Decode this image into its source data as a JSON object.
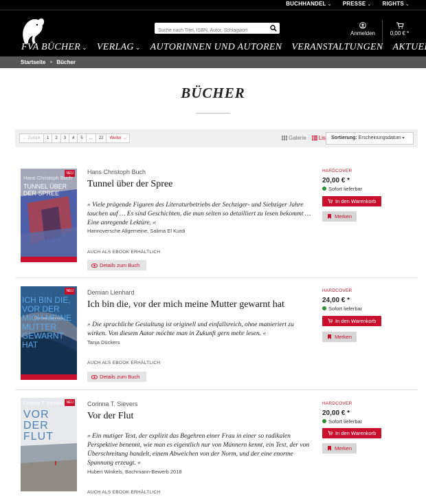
{
  "topbar": {
    "items": [
      {
        "label": "BUCHHANDEL"
      },
      {
        "label": "PRESSE"
      },
      {
        "label": "RIGHTS"
      }
    ]
  },
  "header": {
    "search_placeholder": "Suche nach Titel, ISBN, Autor, Schlagwort",
    "login_label": "Anmelden",
    "cart_label": "0,00 € *",
    "nav": [
      {
        "label": "FVA BÜCHER",
        "has_dropdown": true
      },
      {
        "label": "VERLAG",
        "has_dropdown": true
      },
      {
        "label": "AUTORINNEN UND AUTOREN",
        "has_dropdown": false
      },
      {
        "label": "VERANSTALTUNGEN",
        "has_dropdown": false
      },
      {
        "label": "AKTUELLES",
        "has_dropdown": false
      }
    ]
  },
  "breadcrumb": {
    "items": [
      "Startseite",
      "Bücher"
    ],
    "separator": "»"
  },
  "page": {
    "title": "BÜCHER"
  },
  "pagination": {
    "prev": "← Zurück",
    "pages": [
      "1",
      "2",
      "3",
      "4",
      "5",
      "...",
      "22"
    ],
    "next": "Weiter →"
  },
  "view": {
    "gallery": "Galerie",
    "list": "Liste",
    "active": "list"
  },
  "sort": {
    "label": "Sortierung:",
    "value": "Erscheinungsdatum"
  },
  "colors": {
    "accent": "#c8102e",
    "available": "#2e8b3a",
    "header_bg": "#000000",
    "breadcrumb_bg": "#555555"
  },
  "books": [
    {
      "author": "Hans Christoph Buch",
      "title": "Tunnel über der Spree",
      "badge": "NEU",
      "cover_author": "Hans Christoph Buch",
      "cover_title": "TUNNEL ÜBER DER SPREE",
      "quote": "» Viele prägende Figuren des Literaturbetriebs der Sechziger- und Siebziger Jahre tauchen auf … Es sind Geschichten, die man selten so detailliert zu lesen bekommt … Eine anregende Lektüre. «",
      "source": "Hannoversche Allgemeine, Salima El Kurdi",
      "ebook": "AUCH ALS EBOOK ERHÄLTLICH",
      "details": "Details zum Buch",
      "binding": "HARDCOVER",
      "price": "20,00 € *",
      "availability": "Sofort lieferbar",
      "cart_button": "In den Warenkorb",
      "remember_button": "Merken"
    },
    {
      "author": "Demian Lienhard",
      "title": "Ich bin die, vor der mich meine Mutter gewarnt hat",
      "badge": "NEU",
      "cover_author": "Demian Lienhard",
      "cover_title": "ICH BIN DIE, VOR DER MICH MEINE MUTTER GEWARNT HAT",
      "quote": "» Die sprachliche Gestaltung ist originell und einfallsreich, ohne manieriert zu wirken. Von diesem Autor möchte man in Zukunft gern mehr lesen. «",
      "source": "Tanja Dückers",
      "ebook": "AUCH ALS EBOOK ERHÄLTLICH",
      "details": "Details zum Buch",
      "binding": "HARDCOVER",
      "price": "24,00 € *",
      "availability": "Sofort lieferbar",
      "cart_button": "In den Warenkorb",
      "remember_button": "Merken"
    },
    {
      "author": "Corinna T. Sievers",
      "title": "Vor der Flut",
      "badge": "NEU",
      "cover_author": "Corinna T. Sievers",
      "cover_title": "VOR DER FLUT",
      "quote": "» Ein mutiger Text, der explizit das Begehren einer Frau in einer so radikalen Perspektive benennt, wie man es eigentlich nur von Männern kennt, ein Text, der von Überschreitung handelt, einem Abweichen von der Norm, und der eine enorme Spannung erzeugt. «",
      "source": "Hubert Winkels, Bachmann-Bewerb 2018",
      "ebook": "AUCH ALS EBOOK ERHÄLTLICH",
      "binding": "HARDCOVER",
      "price": "20,00 € *",
      "availability": "Sofort lieferbar",
      "cart_button": "In den Warenkorb",
      "remember_button": "Merken"
    }
  ]
}
